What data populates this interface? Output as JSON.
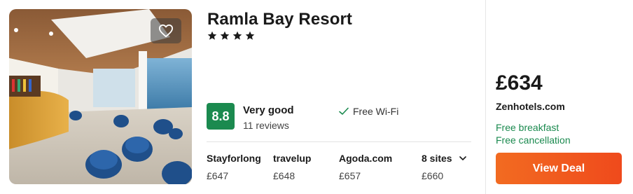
{
  "hotel": {
    "name": "Ramla Bay Resort",
    "star_count": 4,
    "favorite_icon": "heart-icon",
    "star_icon": "star-icon"
  },
  "rating": {
    "score": "8.8",
    "label": "Very good",
    "reviews": "11 reviews",
    "color": "#1b8a4f"
  },
  "amenities": [
    {
      "icon": "check-icon",
      "label": "Free Wi-Fi"
    }
  ],
  "sites": [
    {
      "name": "Stayforlong",
      "price": "£647"
    },
    {
      "name": "travelup",
      "price": "£648"
    },
    {
      "name": "Agoda.com",
      "price": "£657"
    }
  ],
  "more_sites": {
    "label": "8 sites",
    "price": "£660",
    "icon": "chevron-down-icon"
  },
  "deal": {
    "price": "£634",
    "provider": "Zenhotels.com",
    "perks": [
      "Free breakfast",
      "Free cancellation"
    ],
    "button_label": "View Deal",
    "button_color": "#f0561f",
    "perk_color": "#1b8a4f"
  }
}
